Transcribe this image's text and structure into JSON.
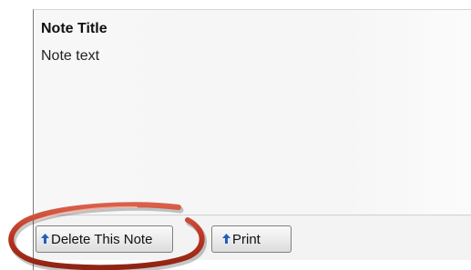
{
  "note": {
    "title": "Note Title",
    "text": "Note text"
  },
  "toolbar": {
    "delete_label": "Delete This Note",
    "print_label": "Print"
  },
  "icons": {
    "arrow": "up-arrow-icon"
  },
  "colors": {
    "highlight": "#b8321e",
    "arrow_icon": "#1f5fbf"
  }
}
